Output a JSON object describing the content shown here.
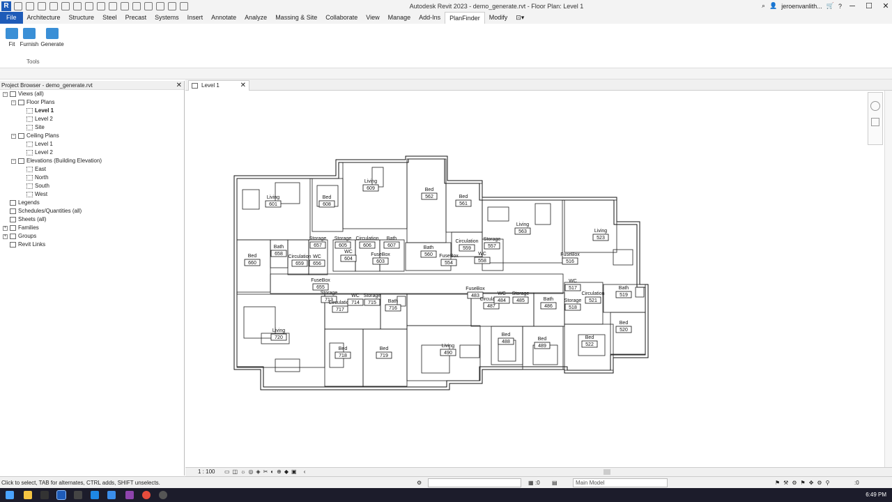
{
  "window": {
    "title": "Autodesk Revit 2023 - demo_generate.rvt - Floor Plan: Level 1",
    "user": "jeroenvanlith..."
  },
  "menu": [
    "File",
    "Architecture",
    "Structure",
    "Steel",
    "Precast",
    "Systems",
    "Insert",
    "Annotate",
    "Analyze",
    "Massing & Site",
    "Collaborate",
    "View",
    "Manage",
    "Add-Ins",
    "PlanFinder",
    "Modify"
  ],
  "ribbon": {
    "buttons": [
      "Fit",
      "Furnish",
      "Generate"
    ],
    "panel_label": "Tools"
  },
  "project_browser": {
    "title": "Project Browser - demo_generate.rvt",
    "tree": [
      {
        "label": "Views (all)",
        "level": 0,
        "toggle": "−"
      },
      {
        "label": "Floor Plans",
        "level": 1,
        "toggle": "−"
      },
      {
        "label": "Level 1",
        "level": 2,
        "bold": true
      },
      {
        "label": "Level 2",
        "level": 2
      },
      {
        "label": "Site",
        "level": 2
      },
      {
        "label": "Ceiling Plans",
        "level": 1,
        "toggle": "−"
      },
      {
        "label": "Level 1",
        "level": 2
      },
      {
        "label": "Level 2",
        "level": 2
      },
      {
        "label": "Elevations (Building Elevation)",
        "level": 1,
        "toggle": "−"
      },
      {
        "label": "East",
        "level": 2
      },
      {
        "label": "North",
        "level": 2
      },
      {
        "label": "South",
        "level": 2
      },
      {
        "label": "West",
        "level": 2
      },
      {
        "label": "Legends",
        "level": 0
      },
      {
        "label": "Schedules/Quantities (all)",
        "level": 0
      },
      {
        "label": "Sheets (all)",
        "level": 0
      },
      {
        "label": "Families",
        "level": 0,
        "toggle": "+"
      },
      {
        "label": "Groups",
        "level": 0,
        "toggle": "+"
      },
      {
        "label": "Revit Links",
        "level": 0
      }
    ]
  },
  "view_tab": {
    "label": "Level 1"
  },
  "view_control": {
    "scale": "1 : 100"
  },
  "status": {
    "message": "Click to select, TAB for alternates, CTRL adds, SHIFT unselects.",
    "model": "Main Model",
    "count": ":0",
    "filter": ":0"
  },
  "taskbar": {
    "clock": "6:49 PM"
  },
  "rooms": [
    {
      "name": "Living",
      "num": "601"
    },
    {
      "name": "Bed",
      "num": "608"
    },
    {
      "name": "Living",
      "num": "609"
    },
    {
      "name": "Bed",
      "num": "562"
    },
    {
      "name": "Bed",
      "num": "561"
    },
    {
      "name": "Living",
      "num": "563"
    },
    {
      "name": "Living",
      "num": "523"
    },
    {
      "name": "Bed",
      "num": "660"
    },
    {
      "name": "Bath",
      "num": "658"
    },
    {
      "name": "Circulation",
      "num": "659"
    },
    {
      "name": "WC",
      "num": "656"
    },
    {
      "name": "Storage",
      "num": "657"
    },
    {
      "name": "Storage",
      "num": "605"
    },
    {
      "name": "Circulation",
      "num": "606"
    },
    {
      "name": "Bath",
      "num": "607"
    },
    {
      "name": "WC",
      "num": "604"
    },
    {
      "name": "FuseBox",
      "num": "603"
    },
    {
      "name": "Bath",
      "num": "560"
    },
    {
      "name": "FuseBox",
      "num": "554"
    },
    {
      "name": "Circulation",
      "num": "559"
    },
    {
      "name": "Storage",
      "num": "557"
    },
    {
      "name": "WC",
      "num": "558"
    },
    {
      "name": "FuseBox",
      "num": "516"
    },
    {
      "name": "FuseBox",
      "num": "655"
    },
    {
      "name": "Storage",
      "num": "713"
    },
    {
      "name": "Circulation",
      "num": "717"
    },
    {
      "name": "WC",
      "num": "714"
    },
    {
      "name": "Storage",
      "num": "715"
    },
    {
      "name": "Bath",
      "num": "716"
    },
    {
      "name": "FuseBox",
      "num": "483"
    },
    {
      "name": "Circulation",
      "num": "487"
    },
    {
      "name": "WC",
      "num": "484"
    },
    {
      "name": "Storage",
      "num": "485"
    },
    {
      "name": "Bath",
      "num": "486"
    },
    {
      "name": "WC",
      "num": "517"
    },
    {
      "name": "Storage",
      "num": "518"
    },
    {
      "name": "Circulation",
      "num": "521"
    },
    {
      "name": "Bath",
      "num": "519"
    },
    {
      "name": "Bed",
      "num": "520"
    },
    {
      "name": "Living",
      "num": "720"
    },
    {
      "name": "Bed",
      "num": "718"
    },
    {
      "name": "Bed",
      "num": "719"
    },
    {
      "name": "Living",
      "num": "490"
    },
    {
      "name": "Bed",
      "num": "488"
    },
    {
      "name": "Bed",
      "num": "489"
    },
    {
      "name": "Bed",
      "num": "522"
    }
  ]
}
